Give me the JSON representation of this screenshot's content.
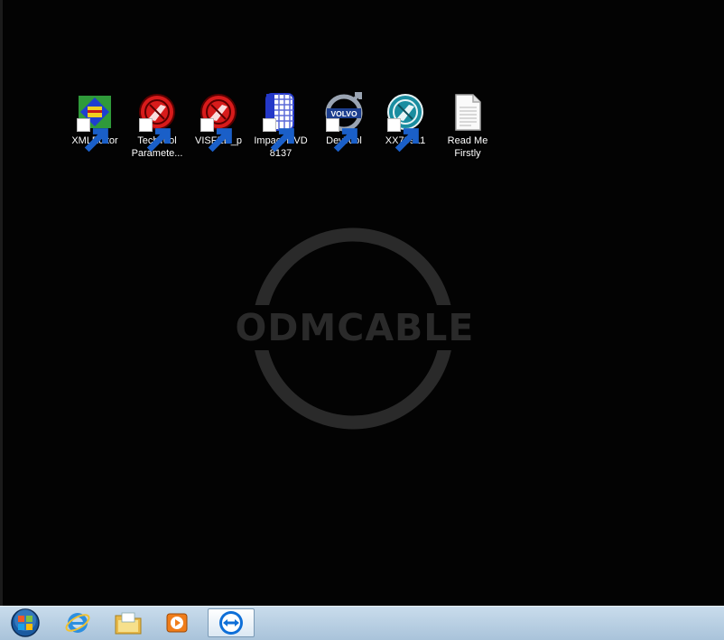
{
  "desktop": {
    "icons": [
      {
        "label": "XMLEditor",
        "icon": "xml-editor-icon"
      },
      {
        "label": "TechTool\nParamete...",
        "icon": "techtool-icon"
      },
      {
        "label": "VISFED_p",
        "icon": "techtool-icon"
      },
      {
        "label": "Impact DVD\n8137",
        "icon": "impact-icon"
      },
      {
        "label": "DevTool",
        "icon": "volvo-icon"
      },
      {
        "label": "XX78911",
        "icon": "techtool-teal-icon"
      },
      {
        "label": "Read Me\nFirstly",
        "icon": "text-document-icon"
      }
    ],
    "watermark": "ODMCABLE",
    "volvo_text": "VOLVO"
  },
  "taskbar": {
    "items": [
      {
        "name": "start-button",
        "icon": "windows-orb-icon"
      },
      {
        "name": "internet-explorer",
        "icon": "internet-explorer-icon"
      },
      {
        "name": "file-explorer",
        "icon": "folder-icon"
      },
      {
        "name": "media-player",
        "icon": "media-player-icon"
      },
      {
        "name": "teamviewer",
        "icon": "teamviewer-icon",
        "active": true
      }
    ]
  },
  "colors": {
    "desktop_bg": "#030303",
    "taskbar_top": "#c9dcec",
    "taskbar_bottom": "#a9c3da",
    "watermark": "#2a2a2a"
  }
}
